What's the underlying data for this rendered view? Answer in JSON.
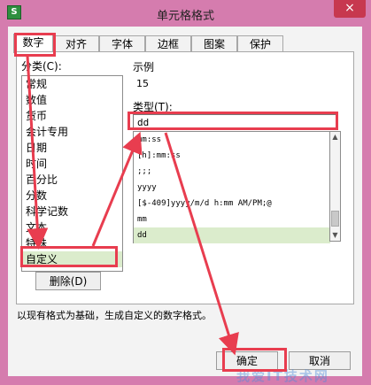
{
  "window": {
    "icon_text": "S",
    "title": "单元格格式",
    "close": "×"
  },
  "tabs": [
    {
      "label": "数字"
    },
    {
      "label": "对齐"
    },
    {
      "label": "字体"
    },
    {
      "label": "边框"
    },
    {
      "label": "图案"
    },
    {
      "label": "保护"
    }
  ],
  "category": {
    "label": "分类(C):",
    "items": [
      "常规",
      "数值",
      "货币",
      "会计专用",
      "日期",
      "时间",
      "百分比",
      "分数",
      "科学记数",
      "文本",
      "特殊",
      "自定义"
    ],
    "selected": "自定义"
  },
  "sample": {
    "label": "示例",
    "value": "15"
  },
  "type": {
    "label": "类型(T):",
    "value": "dd",
    "options": [
      "mm:ss",
      "[h]:mm:ss",
      ";;;",
      "yyyy",
      "[$-409]yyyy/m/d h:mm AM/PM;@",
      "mm",
      "dd"
    ],
    "selected": "dd"
  },
  "buttons": {
    "delete": "删除(D)",
    "ok": "确定",
    "cancel": "取消"
  },
  "hint": "以现有格式为基础，生成自定义的数字格式。",
  "watermark": "我爱IT技术网",
  "colors": {
    "window_background": "#d57cae",
    "highlight": "#dbeccc",
    "annotation_red": "#e83d4f",
    "close_button": "#c7384f"
  },
  "scrollbar": {
    "up_icon": "▲",
    "down_icon": "▼"
  }
}
